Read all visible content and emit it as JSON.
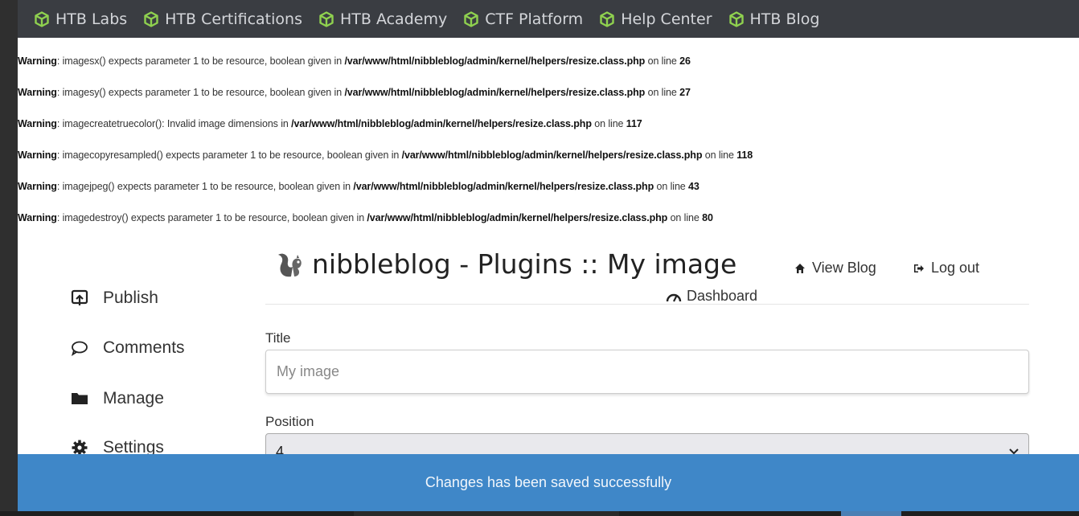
{
  "bookmarks": [
    {
      "label": "HTB Labs",
      "icon": "cube-icon"
    },
    {
      "label": "HTB Certifications",
      "icon": "cube-icon"
    },
    {
      "label": "HTB Academy",
      "icon": "cube-icon"
    },
    {
      "label": "CTF Platform",
      "icon": "cube-icon"
    },
    {
      "label": "Help Center",
      "icon": "cube-icon"
    },
    {
      "label": "HTB Blog",
      "icon": "cube-icon"
    }
  ],
  "warnings": [
    {
      "label": "Warning",
      "message": ": imagesx() expects parameter 1 to be resource, boolean given in ",
      "path": "/var/www/html/nibbleblog/admin/kernel/helpers/resize.class.php",
      "line_text": " on line ",
      "line": "26"
    },
    {
      "label": "Warning",
      "message": ": imagesy() expects parameter 1 to be resource, boolean given in ",
      "path": "/var/www/html/nibbleblog/admin/kernel/helpers/resize.class.php",
      "line_text": " on line ",
      "line": "27"
    },
    {
      "label": "Warning",
      "message": ": imagecreatetruecolor(): Invalid image dimensions in ",
      "path": "/var/www/html/nibbleblog/admin/kernel/helpers/resize.class.php",
      "line_text": " on line ",
      "line": "117"
    },
    {
      "label": "Warning",
      "message": ": imagecopyresampled() expects parameter 1 to be resource, boolean given in ",
      "path": "/var/www/html/nibbleblog/admin/kernel/helpers/resize.class.php",
      "line_text": " on line ",
      "line": "118"
    },
    {
      "label": "Warning",
      "message": ": imagejpeg() expects parameter 1 to be resource, boolean given in ",
      "path": "/var/www/html/nibbleblog/admin/kernel/helpers/resize.class.php",
      "line_text": " on line ",
      "line": "43"
    },
    {
      "label": "Warning",
      "message": ": imagedestroy() expects parameter 1 to be resource, boolean given in ",
      "path": "/var/www/html/nibbleblog/admin/kernel/helpers/resize.class.php",
      "line_text": " on line ",
      "line": "80"
    }
  ],
  "header": {
    "title": "nibbleblog - Plugins :: My image",
    "view_blog": "View Blog",
    "log_out": "Log out",
    "dashboard": "Dashboard"
  },
  "sidebar": {
    "items": [
      {
        "label": "Publish",
        "icon": "publish-icon"
      },
      {
        "label": "Comments",
        "icon": "comment-icon"
      },
      {
        "label": "Manage",
        "icon": "folder-icon"
      },
      {
        "label": "Settings",
        "icon": "gear-icon"
      }
    ]
  },
  "form": {
    "title_label": "Title",
    "title_placeholder": "My image",
    "position_label": "Position",
    "position_value": "4"
  },
  "notification": {
    "text": "Changes has been saved successfully"
  },
  "colors": {
    "bookmark_icon": "#8fd14f",
    "bookmarks_bar": "#3a3d42",
    "notification_bg": "#3f87c8"
  }
}
